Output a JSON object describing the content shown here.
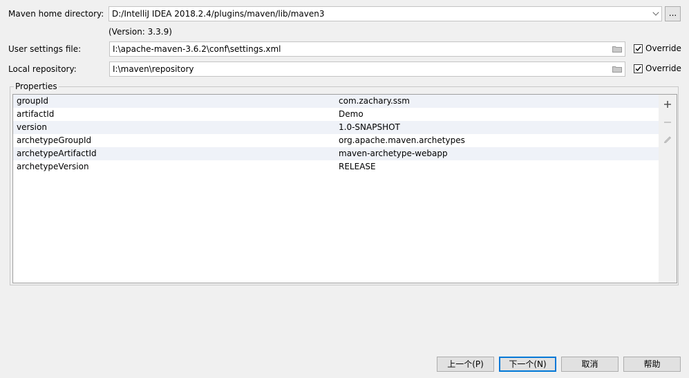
{
  "maven_home": {
    "label": "Maven home directory:",
    "value": "D:/IntelliJ IDEA 2018.2.4/plugins/maven/lib/maven3",
    "browse_label": "...",
    "version": "(Version: 3.3.9)"
  },
  "user_settings": {
    "label": "User settings file:",
    "value": "I:\\apache-maven-3.6.2\\conf\\settings.xml",
    "override_label": "Override",
    "override_checked": true
  },
  "local_repo": {
    "label": "Local repository:",
    "value": "I:\\maven\\repository",
    "override_label": "Override",
    "override_checked": true
  },
  "properties": {
    "title": "Properties",
    "rows": [
      {
        "key": "groupId",
        "value": "com.zachary.ssm"
      },
      {
        "key": "artifactId",
        "value": "Demo"
      },
      {
        "key": "version",
        "value": "1.0-SNAPSHOT"
      },
      {
        "key": "archetypeGroupId",
        "value": "org.apache.maven.archetypes"
      },
      {
        "key": "archetypeArtifactId",
        "value": "maven-archetype-webapp"
      },
      {
        "key": "archetypeVersion",
        "value": "RELEASE"
      }
    ],
    "toolbar_icons": [
      "plus-icon",
      "minus-icon",
      "edit-icon"
    ]
  },
  "buttons": {
    "previous": "上一个(P)",
    "next": "下一个(N)",
    "cancel": "取消",
    "help": "帮助"
  },
  "colors": {
    "row_alt": "#eff2f8",
    "primary_border": "#0078d7"
  }
}
